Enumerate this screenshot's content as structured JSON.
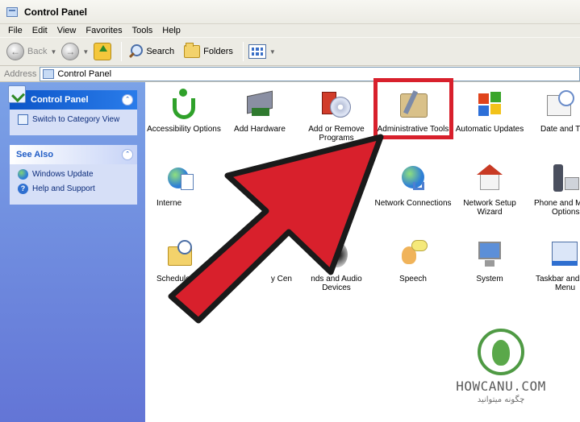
{
  "window": {
    "title": "Control Panel"
  },
  "menu": [
    "File",
    "Edit",
    "View",
    "Favorites",
    "Tools",
    "Help"
  ],
  "toolbar": {
    "back_label": "Back",
    "search_label": "Search",
    "folders_label": "Folders"
  },
  "address": {
    "label": "Address",
    "value": "Control Panel"
  },
  "sidebar": {
    "panel1": {
      "title": "Control Panel",
      "link": "Switch to Category View"
    },
    "panel2": {
      "title": "See Also",
      "links": [
        "Windows Update",
        "Help and Support"
      ]
    }
  },
  "items": [
    {
      "label": "Accessibility Options",
      "icon": "accessibility-icon"
    },
    {
      "label": "Add Hardware",
      "icon": "add-hardware-icon"
    },
    {
      "label": "Add or Remove Programs",
      "icon": "add-remove-programs-icon"
    },
    {
      "label": "Administrative Tools",
      "icon": "administrative-tools-icon",
      "highlighted": true
    },
    {
      "label": "Automatic Updates",
      "icon": "automatic-updates-icon"
    },
    {
      "label": "Date and T",
      "icon": "date-time-icon"
    },
    {
      "label": "Interne",
      "icon": "internet-options-icon"
    },
    {
      "label": "Network Connections",
      "icon": "network-connections-icon"
    },
    {
      "label": "Network Setup Wizard",
      "icon": "network-setup-wizard-icon"
    },
    {
      "label": "Phone and M",
      "label_line2": "Options",
      "icon": "phone-modem-icon"
    },
    {
      "label": "Scheduled T",
      "icon": "scheduled-tasks-icon"
    },
    {
      "label": "y Cen",
      "icon": "security-center-icon"
    },
    {
      "label": "nds and Audio",
      "label_line2": "Devices",
      "icon": "sounds-audio-icon"
    },
    {
      "label": "Speech",
      "icon": "speech-icon"
    },
    {
      "label": "System",
      "icon": "system-icon"
    },
    {
      "label": "Taskbar and",
      "label_line2": "Menu",
      "icon": "taskbar-start-menu-icon"
    }
  ],
  "colors": {
    "highlight": "#d8202c",
    "arrow": "#d8202c",
    "sidebar": "#6f8fe0"
  },
  "watermark": {
    "brand": "HOWCANU.COM",
    "tagline": "چگونه میتوانید"
  }
}
